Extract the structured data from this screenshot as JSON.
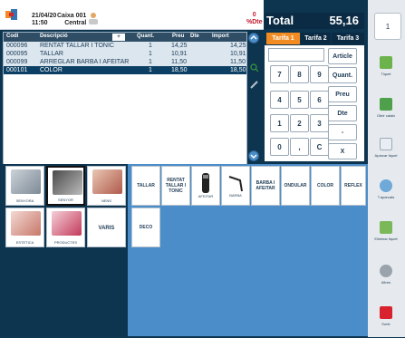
{
  "header": {
    "date": "21/04/20",
    "time": "11:50",
    "caixa": "Caixa 001",
    "location": "Central",
    "pct_dte_value": "0",
    "pct_dte_label": "%Dte"
  },
  "table": {
    "columns": [
      "Codi",
      "Descripció",
      "Quant.",
      "Preu",
      "Dte",
      "Import"
    ],
    "rows": [
      {
        "codi": "000096",
        "desc": "RENTAT TALLAR I TONIC",
        "quant": "1",
        "preu": "14,25",
        "dte": "",
        "import": "14,25"
      },
      {
        "codi": "000095",
        "desc": "TALLAR",
        "quant": "1",
        "preu": "10,91",
        "dte": "",
        "import": "10,91"
      },
      {
        "codi": "000099",
        "desc": "ARREGLAR BARBA I AFEITAR",
        "quant": "1",
        "preu": "11,50",
        "dte": "",
        "import": "11,50"
      },
      {
        "codi": "000101",
        "desc": "COLOR",
        "quant": "1",
        "preu": "18,50",
        "dte": "",
        "import": "18,50"
      }
    ]
  },
  "total": {
    "label": "Total",
    "value": "55,16"
  },
  "tarifes": [
    "Tarifa 1",
    "Tarifa 2",
    "Tarifa 3"
  ],
  "keypad": {
    "digits": [
      "7",
      "8",
      "9",
      "4",
      "5",
      "6",
      "1",
      "2",
      "3",
      "0",
      ",",
      "C"
    ],
    "functions": [
      "Article",
      "Quant.",
      "Preu",
      "Dte",
      "-",
      "X"
    ]
  },
  "sidebar": {
    "counter": "1",
    "buttons": [
      {
        "label": "Tiquet",
        "icon": "printer-icon"
      },
      {
        "label": "Obrir calaix",
        "icon": "cash-drawer-icon"
      },
      {
        "label": "Aparcar tiquet",
        "icon": "bag-icon"
      },
      {
        "label": "T.aparcats",
        "icon": "magnifier-icon"
      },
      {
        "label": "Eliminar tiquet",
        "icon": "trash-icon"
      },
      {
        "label": "Altres",
        "icon": "gears-icon"
      },
      {
        "label": "Sortir",
        "icon": "exit-icon"
      }
    ]
  },
  "categories": [
    {
      "label": "SENYORA"
    },
    {
      "label": "SENYOR"
    },
    {
      "label": "NENS"
    },
    {
      "label": "ESTETICA"
    },
    {
      "label": "PRODUCTES"
    },
    {
      "label": "VARIS"
    }
  ],
  "products": [
    {
      "label": "TALLAR"
    },
    {
      "label": "RENTAT TALLAR I TONIC"
    },
    {
      "label": "AFEITAR"
    },
    {
      "label": "BARBA"
    },
    {
      "label": "BARBA I AFEITAR"
    },
    {
      "label": "ONDULAR"
    },
    {
      "label": "COLOR"
    },
    {
      "label": "REFLEX"
    },
    {
      "label": "DECO"
    }
  ],
  "colors": {
    "accent": "#4b8dc8",
    "header_dark": "#0b2b44",
    "tarifa_active": "#f28c22",
    "exit_red": "#d8222e"
  }
}
